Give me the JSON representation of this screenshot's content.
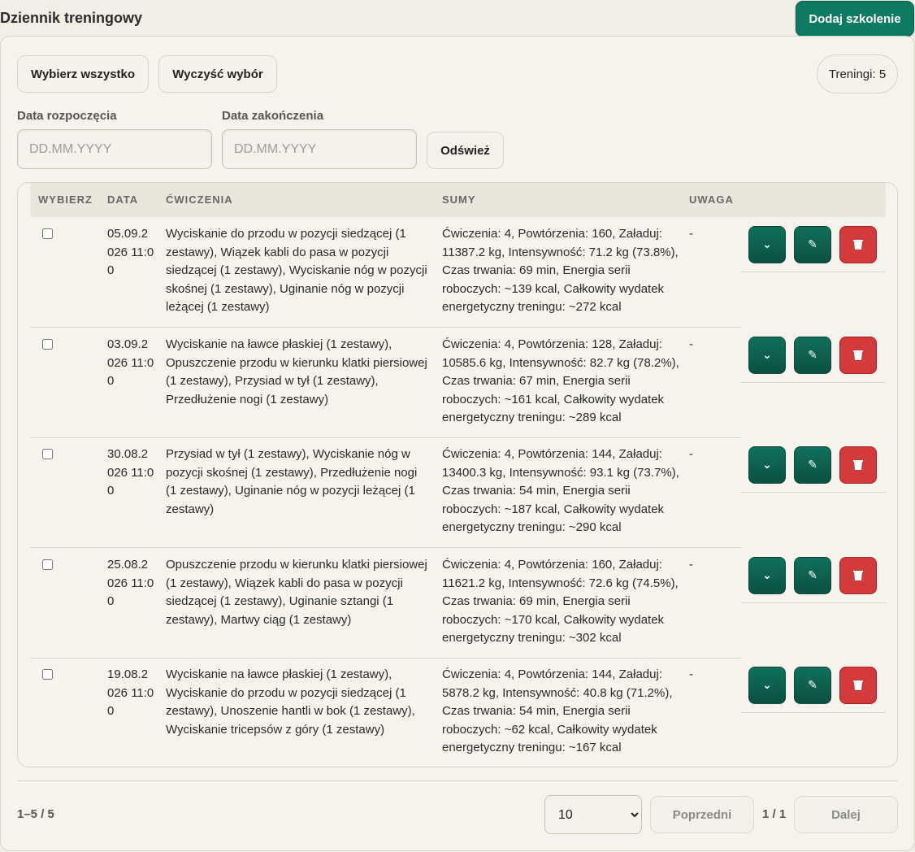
{
  "header": {
    "title": "Dziennik treningowy",
    "add_label": "Dodaj szkolenie"
  },
  "toolbar": {
    "select_all": "Wybierz wszystko",
    "clear_selection": "Wyczyść wybór",
    "count_label": "Treningi: 5"
  },
  "filters": {
    "start_label": "Data rozpoczęcia",
    "end_label": "Data zakończenia",
    "start_placeholder": "DD.MM.YYYY",
    "end_placeholder": "DD.MM.YYYY",
    "refresh_label": "Odśwież"
  },
  "table": {
    "columns": [
      "WYBIERZ",
      "DATA",
      "ĆWICZENIA",
      "SUMY",
      "UWAGA"
    ],
    "rows": [
      {
        "date": "05.09.2026 11:00",
        "exercises": "Wyciskanie do przodu w pozycji siedzącej (1 zestawy), Wiązek kabli do pasa w pozycji siedzącej (1 zestawy), Wyciskanie nóg w pozycji skośnej (1 zestawy), Uginanie nóg w pozycji leżącej (1 zestawy)",
        "sums": "Ćwiczenia: 4, Powtórzenia: 160, Załaduj: 11387.2 kg, Intensywność: 71.2 kg (73.8%), Czas trwania: 69 min, Energia serii roboczych: ~139 kcal, Całkowity wydatek energetyczny treningu: ~272 kcal",
        "note": "-"
      },
      {
        "date": "03.09.2026 11:00",
        "exercises": "Wyciskanie na ławce płaskiej (1 zestawy), Opuszczenie przodu w kierunku klatki piersiowej (1 zestawy), Przysiad w tył (1 zestawy), Przedłużenie nogi (1 zestawy)",
        "sums": "Ćwiczenia: 4, Powtórzenia: 128, Załaduj: 10585.6 kg, Intensywność: 82.7 kg (78.2%), Czas trwania: 67 min, Energia serii roboczych: ~161 kcal, Całkowity wydatek energetyczny treningu: ~289 kcal",
        "note": "-"
      },
      {
        "date": "30.08.2026 11:00",
        "exercises": "Przysiad w tył (1 zestawy), Wyciskanie nóg w pozycji skośnej (1 zestawy), Przedłużenie nogi (1 zestawy), Uginanie nóg w pozycji leżącej (1 zestawy)",
        "sums": "Ćwiczenia: 4, Powtórzenia: 144, Załaduj: 13400.3 kg, Intensywność: 93.1 kg (73.7%), Czas trwania: 54 min, Energia serii roboczych: ~187 kcal, Całkowity wydatek energetyczny treningu: ~290 kcal",
        "note": "-"
      },
      {
        "date": "25.08.2026 11:00",
        "exercises": "Opuszczenie przodu w kierunku klatki piersiowej (1 zestawy), Wiązek kabli do pasa w pozycji siedzącej (1 zestawy), Uginanie sztangi (1 zestawy), Martwy ciąg (1 zestawy)",
        "sums": "Ćwiczenia: 4, Powtórzenia: 160, Załaduj: 11621.2 kg, Intensywność: 72.6 kg (74.5%), Czas trwania: 69 min, Energia serii roboczych: ~170 kcal, Całkowity wydatek energetyczny treningu: ~302 kcal",
        "note": "-"
      },
      {
        "date": "19.08.2026 11:00",
        "exercises": "Wyciskanie na ławce płaskiej (1 zestawy), Wyciskanie do przodu w pozycji siedzącej (1 zestawy), Unoszenie hantli w bok (1 zestawy), Wyciskanie tricepsów z góry (1 zestawy)",
        "sums": "Ćwiczenia: 4, Powtórzenia: 144, Załaduj: 5878.2 kg, Intensywność: 40.8 kg (71.2%), Czas trwania: 54 min, Energia serii roboczych: ~62 kcal, Całkowity wydatek energetyczny treningu: ~167 kcal",
        "note": "-"
      }
    ],
    "action_icons": {
      "expand": "chevron-down-icon",
      "edit": "pencil-icon",
      "delete": "trash-icon"
    },
    "action_glyphs": {
      "expand": "⌄",
      "edit": "✎",
      "delete": "🗑"
    }
  },
  "pagination": {
    "range_text": "1–5 / 5",
    "page_size": "10",
    "page_size_options": [
      "10"
    ],
    "prev_label": "Poprzedni",
    "page_indicator": "1 / 1",
    "next_label": "Dalej"
  },
  "colors": {
    "accent": "#0f7a63",
    "danger": "#d23a3c",
    "background": "#f1eee6"
  }
}
